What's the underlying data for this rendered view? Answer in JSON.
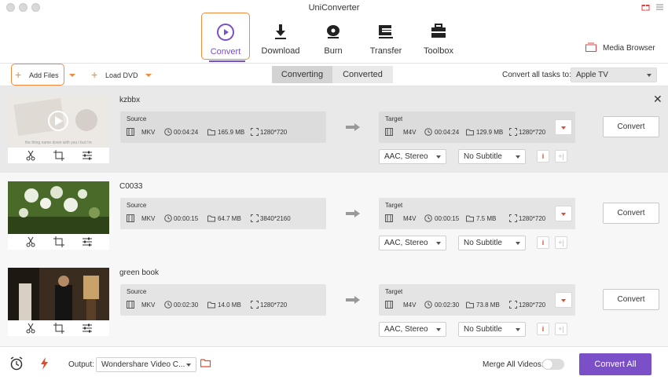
{
  "app": {
    "title": "UniConverter"
  },
  "nav": [
    {
      "label": "Convert",
      "icon": "convert-icon",
      "active": true
    },
    {
      "label": "Download",
      "icon": "download-icon"
    },
    {
      "label": "Burn",
      "icon": "burn-icon"
    },
    {
      "label": "Transfer",
      "icon": "transfer-icon"
    },
    {
      "label": "Toolbox",
      "icon": "toolbox-icon"
    }
  ],
  "media_browser": {
    "label": "Media Browser"
  },
  "actionbar": {
    "add_files": "Add Files",
    "load_dvd": "Load DVD",
    "tabs": [
      "Converting",
      "Converted"
    ],
    "active_tab": "Converting",
    "convert_all_to_label": "Convert all tasks to:",
    "convert_all_to_value": "Apple TV"
  },
  "labels": {
    "source": "Source",
    "target": "Target",
    "convert": "Convert"
  },
  "files": [
    {
      "name": "kzbbx",
      "source": {
        "format": "MKV",
        "duration": "00:04:24",
        "size": "165.9 MB",
        "resolution": "1280*720"
      },
      "target": {
        "format": "M4V",
        "duration": "00:04:24",
        "size": "129.9 MB",
        "resolution": "1280*720"
      },
      "audio": "AAC, Stereo",
      "subtitle": "No Subtitle",
      "thumb_caption": "the thing name down with you i but i'm",
      "thumb_colors": [
        "#e8e3df",
        "#cfc8c3"
      ]
    },
    {
      "name": "C0033",
      "source": {
        "format": "MKV",
        "duration": "00:00:15",
        "size": "64.7 MB",
        "resolution": "3840*2160"
      },
      "target": {
        "format": "M4V",
        "duration": "00:00:15",
        "size": "7.5 MB",
        "resolution": "1280*720"
      },
      "audio": "AAC, Stereo",
      "subtitle": "No Subtitle",
      "thumb_colors": [
        "#3f5a24",
        "#8aa15c"
      ]
    },
    {
      "name": "green book",
      "source": {
        "format": "MKV",
        "duration": "00:02:30",
        "size": "14.0 MB",
        "resolution": "1280*720"
      },
      "target": {
        "format": "M4V",
        "duration": "00:02:30",
        "size": "73.8 MB",
        "resolution": "1280*720"
      },
      "audio": "AAC, Stereo",
      "subtitle": "No Subtitle",
      "thumb_colors": [
        "#2b2218",
        "#7a5a3a"
      ]
    }
  ],
  "footer": {
    "output_label": "Output:",
    "output_value": "Wondershare Video C...",
    "merge_label": "Merge All Videos:",
    "merge_enabled": false,
    "convert_all": "Convert All"
  },
  "colors": {
    "accent": "#7a4fc7",
    "orange": "#f08a3c",
    "red": "#e24a2e"
  }
}
